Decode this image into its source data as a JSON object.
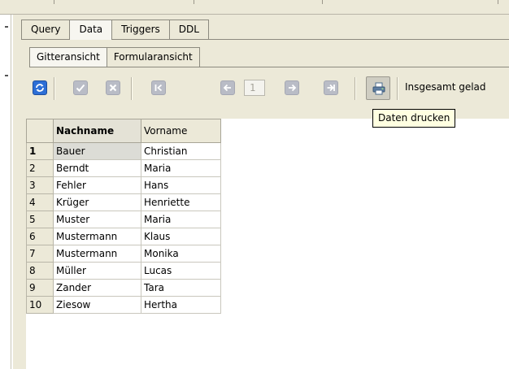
{
  "editor_tabs": [
    {
      "label": "Query",
      "active": false
    },
    {
      "label": "Data",
      "active": true
    },
    {
      "label": "Triggers",
      "active": false
    },
    {
      "label": "DDL",
      "active": false
    }
  ],
  "view_tabs": [
    {
      "label": "Gitteransicht",
      "active": true
    },
    {
      "label": "Formularansicht",
      "active": false
    }
  ],
  "toolbar": {
    "icons": [
      "refresh-icon",
      "post-icon",
      "cancel-icon",
      "first-record-icon",
      "prior-record-icon",
      "next-record-icon",
      "last-record-icon",
      "print-icon"
    ],
    "page_value": "1",
    "status_text": "Insgesamt gelad",
    "colors": {
      "active_button": "#2d6fd6",
      "disabled_button": "#b9bcc6"
    }
  },
  "tooltip": {
    "text": "Daten drucken"
  },
  "grid": {
    "columns": [
      {
        "label": "Nachname",
        "sorted": true
      },
      {
        "label": "Vorname",
        "sorted": false
      }
    ],
    "current_row": 1,
    "rows": [
      {
        "no": "1",
        "nachname": "Bauer",
        "vorname": "Christian"
      },
      {
        "no": "2",
        "nachname": "Berndt",
        "vorname": "Maria"
      },
      {
        "no": "3",
        "nachname": "Fehler",
        "vorname": "Hans"
      },
      {
        "no": "4",
        "nachname": "Krüger",
        "vorname": "Henriette"
      },
      {
        "no": "5",
        "nachname": "Muster",
        "vorname": "Maria"
      },
      {
        "no": "6",
        "nachname": "Mustermann",
        "vorname": "Klaus"
      },
      {
        "no": "7",
        "nachname": "Mustermann",
        "vorname": "Monika"
      },
      {
        "no": "8",
        "nachname": "Müller",
        "vorname": "Lucas"
      },
      {
        "no": "9",
        "nachname": "Zander",
        "vorname": "Tara"
      },
      {
        "no": "10",
        "nachname": "Ziesow",
        "vorname": "Hertha"
      }
    ]
  }
}
